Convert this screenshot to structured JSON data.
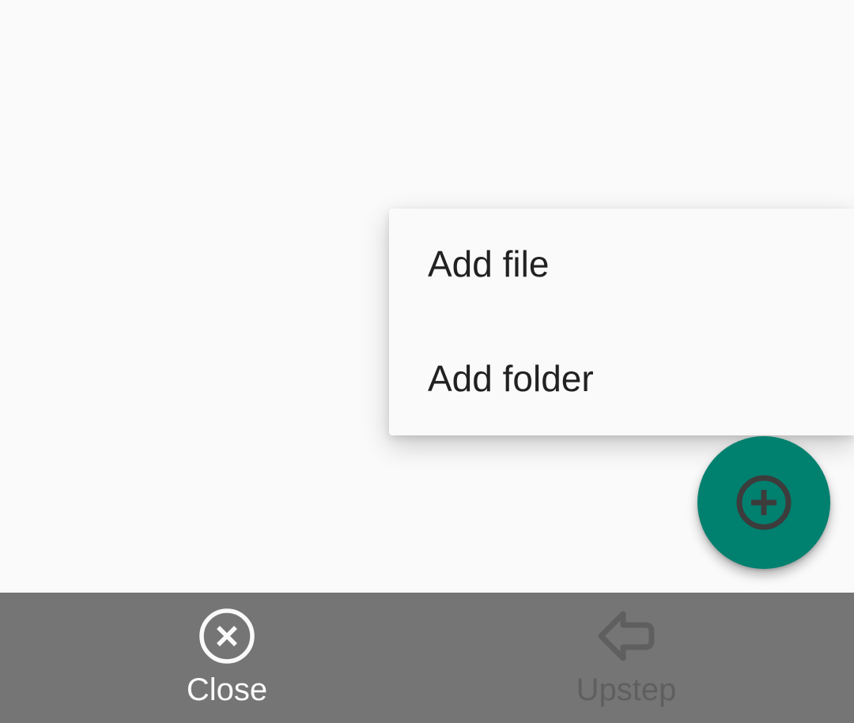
{
  "popup_menu": {
    "items": [
      {
        "label": "Add file"
      },
      {
        "label": "Add folder"
      }
    ]
  },
  "fab": {
    "icon": "add-circle-icon",
    "color": "#00806f"
  },
  "bottom_bar": {
    "close": {
      "label": "Close",
      "icon": "close-circle-icon"
    },
    "upstep": {
      "label": "Upstep",
      "icon": "arrow-left-icon",
      "disabled": true
    }
  },
  "colors": {
    "background": "#fafafa",
    "bottom_bar": "#757575",
    "accent": "#00806f"
  }
}
